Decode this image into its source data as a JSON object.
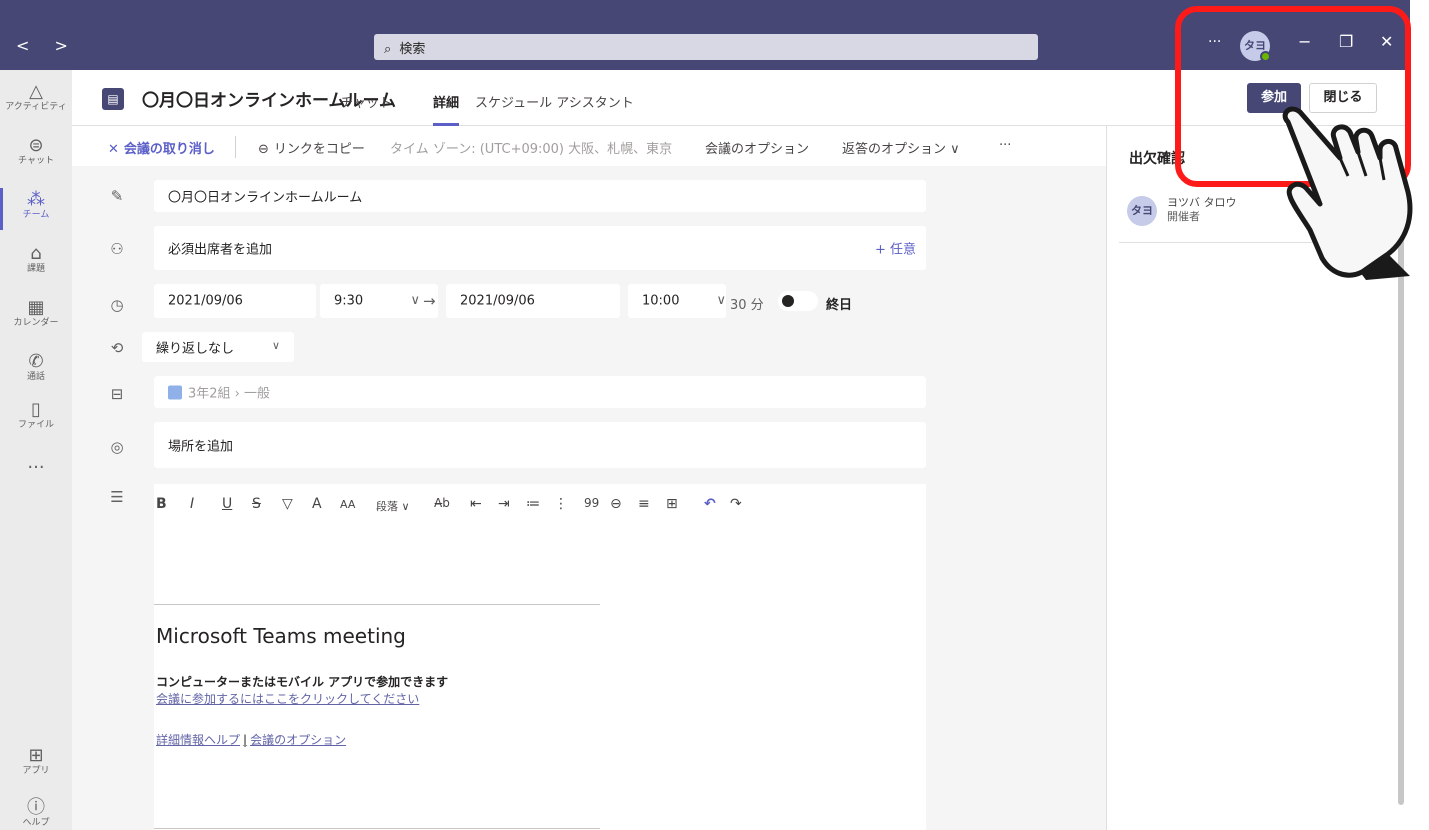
{
  "titlebar": {
    "nav": "< >",
    "search_placeholder": "検索",
    "more": "···",
    "avatar": "タヨ",
    "minimize": "−",
    "maximize": "❐",
    "close": "✕"
  },
  "rail": [
    {
      "label": "アクティビティ",
      "icon": "bell-icon",
      "glyph": "🔔"
    },
    {
      "label": "チャット",
      "icon": "chat-icon",
      "glyph": "☺"
    },
    {
      "label": "チーム",
      "icon": "teams-icon",
      "glyph": "👥"
    },
    {
      "label": "課題",
      "icon": "assignment-icon",
      "glyph": "🎓"
    },
    {
      "label": "カレンダー",
      "icon": "calendar-icon",
      "glyph": "▦"
    },
    {
      "label": "通話",
      "icon": "phone-icon",
      "glyph": "✆"
    },
    {
      "label": "ファイル",
      "icon": "file-icon",
      "glyph": "▯"
    },
    {
      "label": "···",
      "icon": "more-icon",
      "glyph": ""
    },
    {
      "label": "アプリ",
      "icon": "apps-icon",
      "glyph": "⊞"
    },
    {
      "label": "ヘルプ",
      "icon": "help-icon",
      "glyph": "?"
    }
  ],
  "header": {
    "title": "〇月〇日オンラインホームルーム",
    "tabs": [
      "チャット",
      "詳細",
      "スケジュール アシスタント"
    ],
    "active_tab": "詳細",
    "join_label": "参加",
    "close_label": "閉じる"
  },
  "toolbar": {
    "cancel": "会議の取り消し",
    "copy_link": "リンクをコピー",
    "timezone": "タイム ゾーン: (UTC+09:00) 大阪、札幌、東京",
    "meeting_options": "会議のオプション",
    "response_options": "返答のオプション",
    "more": "···"
  },
  "form": {
    "title_value": "〇月〇日オンラインホームルーム",
    "attendees_placeholder": "必須出席者を追加",
    "optional_label": "+ 任意",
    "start_date": "2021/09/06",
    "start_time": "9:30",
    "end_date": "2021/09/06",
    "end_time": "10:00",
    "duration": "30 分",
    "all_day": "終日",
    "repeat": "繰り返しなし",
    "channel_team": "3年2組",
    "channel_name": "一般",
    "location_placeholder": "場所を追加"
  },
  "editor": {
    "heading_label": "段落",
    "meeting_heading": "Microsoft Teams meeting",
    "join_subtitle": "コンピューターまたはモバイル アプリで参加できます",
    "join_link": "会議に参加するにはここをクリックしてください",
    "help_link": "詳細情報ヘルプ",
    "options_link": "会議のオプション"
  },
  "attendance": {
    "title": "出欠確認",
    "avatar": "タヨ",
    "name": "ヨツバ タロウ",
    "role": "開催者"
  },
  "colors": {
    "brand": "#464775",
    "accent": "#5b5fc7",
    "annotation": "#ff1a1a"
  }
}
